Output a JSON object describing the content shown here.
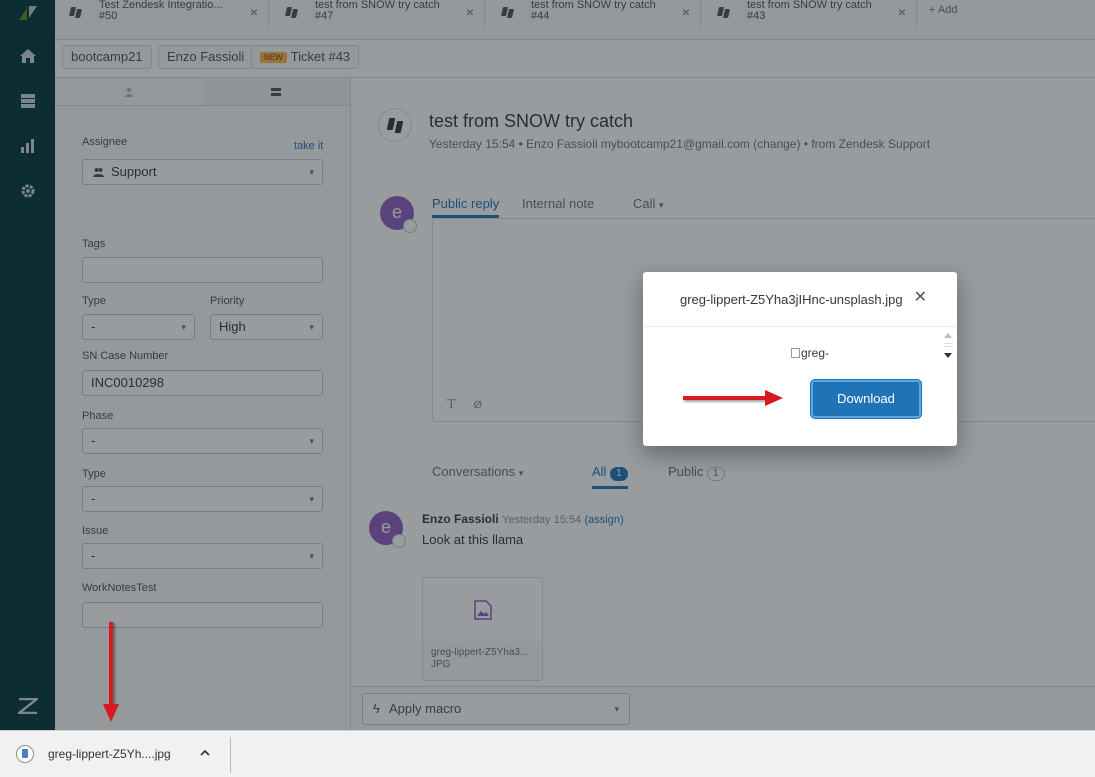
{
  "tabs": [
    {
      "title": "Test Zendesk Integratio...",
      "sub": "#50"
    },
    {
      "title": "test from SNOW try catch",
      "sub": "#47"
    },
    {
      "title": "test from SNOW try catch",
      "sub": "#44"
    },
    {
      "title": "test from SNOW try catch",
      "sub": "#43"
    }
  ],
  "add_tab_label": "+ Add",
  "breadcrumbs": {
    "org": "bootcamp21",
    "user": "Enzo Fassioli",
    "badge": "NEW",
    "ticket": "Ticket #43"
  },
  "properties": {
    "assignee_label": "Assignee",
    "take_it": "take it",
    "assignee_value": "Support",
    "tags_label": "Tags",
    "type_label": "Type",
    "type_value": "-",
    "priority_label": "Priority",
    "priority_value": "High",
    "sn_case_label": "SN Case Number",
    "sn_case_value": "INC0010298",
    "phase_label": "Phase",
    "phase_value": "-",
    "type2_label": "Type",
    "type2_value": "-",
    "issue_label": "Issue",
    "issue_value": "-",
    "worknotes_label": "WorkNotesTest"
  },
  "ticket": {
    "title": "test from SNOW try catch",
    "meta": "Yesterday 15:54 • Enzo Fassioli   mybootcamp21@gmail.com (change) • from Zendesk Support"
  },
  "reply": {
    "avatar_letter": "e",
    "tabs": [
      "Public reply",
      "Internal note",
      "Call"
    ]
  },
  "conversations": {
    "label": "Conversations",
    "all_label": "All",
    "all_count": "1",
    "public_label": "Public",
    "public_count": "1"
  },
  "comment": {
    "avatar_letter": "e",
    "author": "Enzo Fassioli",
    "time": "Yesterday 15:54",
    "assign": "(assign)",
    "text": "Look at this llama",
    "attachment_name": "greg-lippert-Z5Yha3...",
    "attachment_ext": "JPG"
  },
  "macro_label": "Apply macro",
  "modal": {
    "filename": "greg-lippert-Z5Yha3jIHnc-unsplash.jpg",
    "broken_image_alt": "greg-",
    "download_label": "Download"
  },
  "download_bar": {
    "filename": "greg-lippert-Z5Yh....jpg"
  },
  "colors": {
    "rail": "#03363d",
    "accent": "#1f73b7",
    "annotation_arrow": "#d71920"
  }
}
